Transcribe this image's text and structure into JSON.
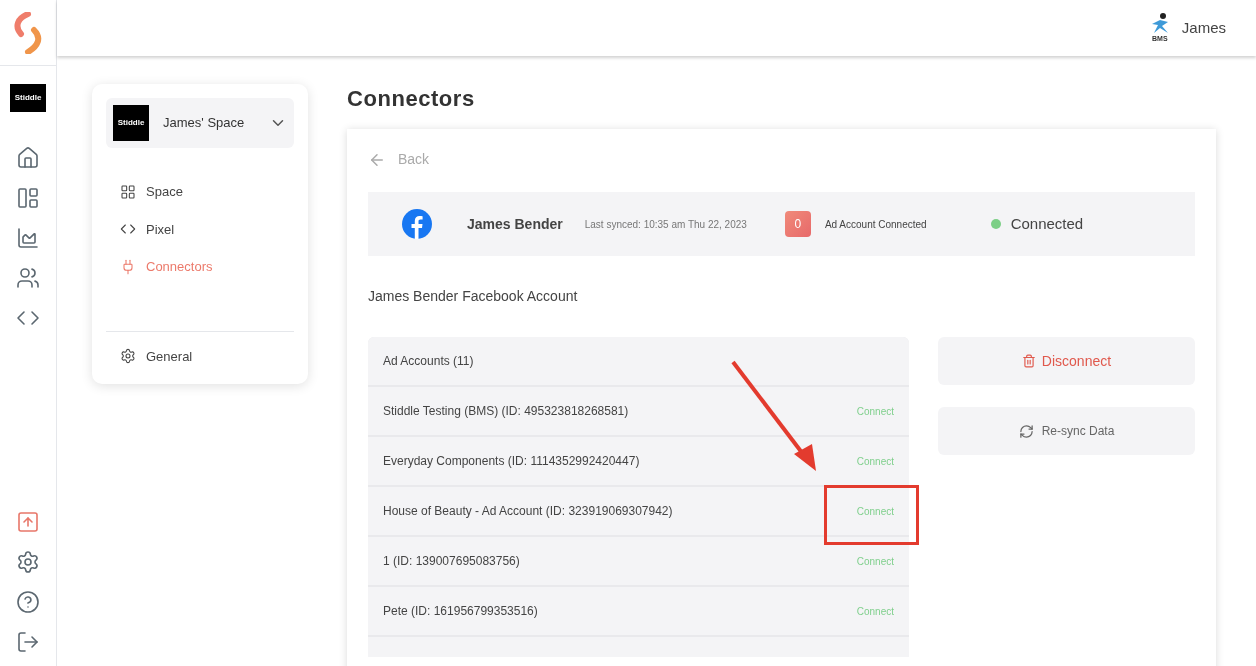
{
  "rail": {
    "workspace_logo": "Stiddle"
  },
  "header": {
    "user_logo": "BMS",
    "user_name": "James"
  },
  "page_title": "Connectors",
  "space_menu": {
    "space_logo": "Stiddle",
    "space_name": "James' Space",
    "items": [
      {
        "label": "Space",
        "selected": false
      },
      {
        "label": "Pixel",
        "selected": false
      },
      {
        "label": "Connectors",
        "selected": true
      }
    ],
    "footer_item": {
      "label": "General"
    }
  },
  "back_link": "Back",
  "account_bar": {
    "name": "James Bender",
    "last_synced": "Last synced: 10:35 am Thu 22, 2023",
    "count": "0",
    "count_label": "Ad Account Connected",
    "status": "Connected",
    "connected": true
  },
  "section_title": "James Bender Facebook Account",
  "ad_accounts": {
    "heading": "Ad Accounts (11)",
    "rows": [
      {
        "name": "Stiddle Testing (BMS) (ID: 495323818268581)",
        "action": "Connect"
      },
      {
        "name": "Everyday Components (ID: 1114352992420447)",
        "action": "Connect"
      },
      {
        "name": "House of Beauty - Ad Account (ID: 323919069307942)",
        "action": "Connect"
      },
      {
        "name": "1 (ID: 139007695083756)",
        "action": "Connect"
      },
      {
        "name": "Pete (ID: 161956799353516)",
        "action": "Connect"
      }
    ]
  },
  "actions": {
    "disconnect": "Disconnect",
    "resync": "Re-sync Data"
  }
}
